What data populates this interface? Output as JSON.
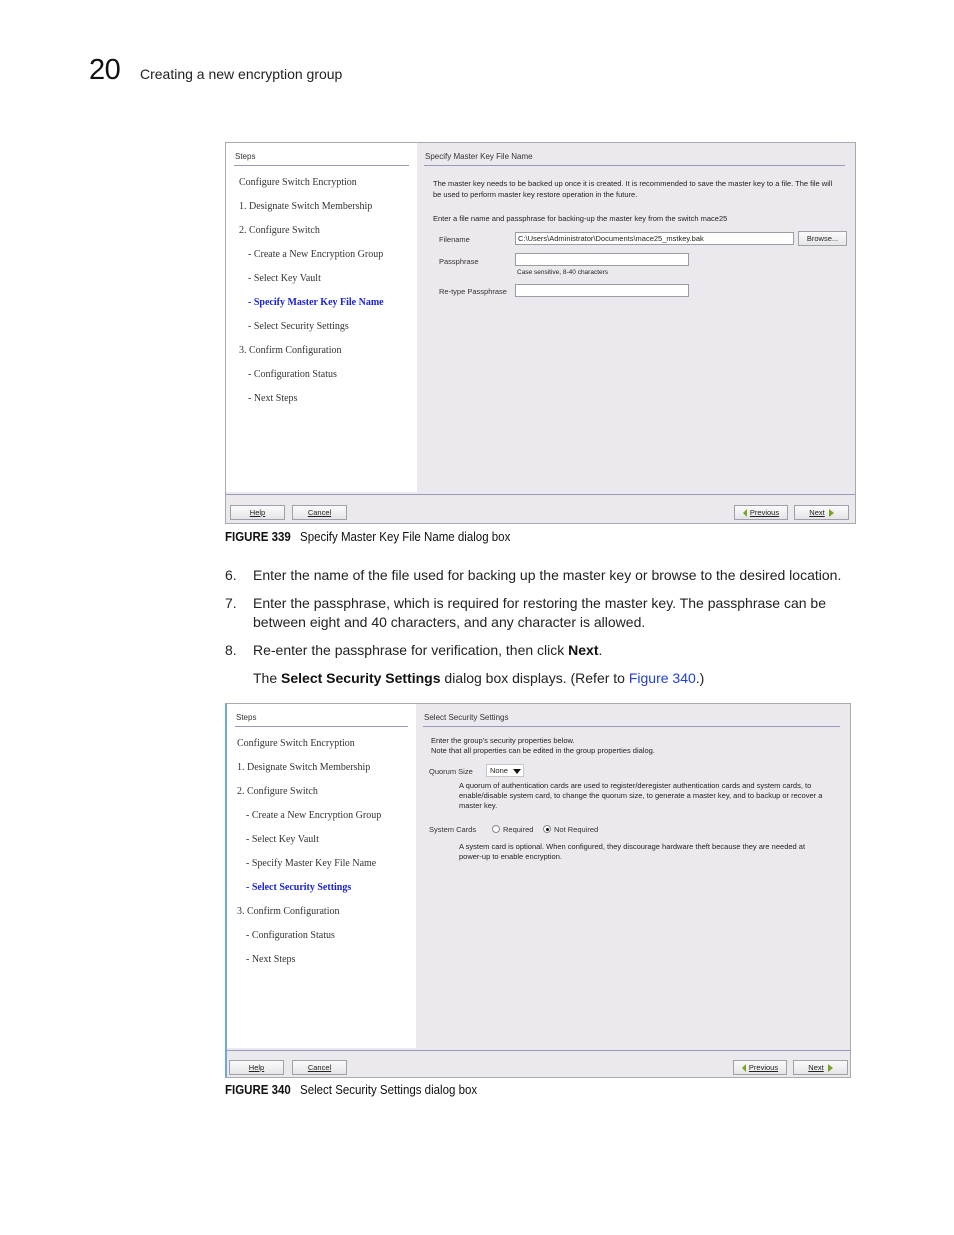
{
  "header": {
    "chapter_number": "20",
    "chapter_title": "Creating a new encryption group"
  },
  "figure339": {
    "steps_heading": "Steps",
    "steps": [
      {
        "label": "Configure Switch Encryption",
        "level": 0,
        "active": false
      },
      {
        "label": "1. Designate Switch Membership",
        "level": 0,
        "active": false
      },
      {
        "label": "2. Configure Switch",
        "level": 0,
        "active": false
      },
      {
        "label": "- Create a New Encryption Group",
        "level": 1,
        "active": false
      },
      {
        "label": "- Select Key Vault",
        "level": 1,
        "active": false
      },
      {
        "label": "- Specify Master Key File Name",
        "level": 1,
        "active": true
      },
      {
        "label": "- Select Security Settings",
        "level": 1,
        "active": false
      },
      {
        "label": "3. Confirm Configuration",
        "level": 0,
        "active": false
      },
      {
        "label": "- Configuration Status",
        "level": 1,
        "active": false
      },
      {
        "label": "- Next Steps",
        "level": 1,
        "active": false
      }
    ],
    "content_heading": "Specify Master Key File Name",
    "intro_line1": "The master key needs to be backed up once it is created. It is recommended to save the master key to a file. The file will",
    "intro_line2": "be used to perform master key restore operation in the future.",
    "instruction": "Enter a file name and passphrase for backing-up the master key from the switch mace25",
    "filename_label": "Filename",
    "filename_value": "C:\\Users\\Administrator\\Documents\\mace25_mstkey.bak",
    "browse_label": "Browse...",
    "passphrase_label": "Passphrase",
    "passphrase_value": "",
    "passphrase_hint": "Case sensitive, 8-40 characters",
    "retype_label": "Re-type Passphrase",
    "retype_value": "",
    "buttons": {
      "help": "Help",
      "cancel": "Cancel",
      "previous": "Previous",
      "next": "Next"
    },
    "caption_number": "FIGURE 339",
    "caption_text": "Specify Master Key File Name dialog box"
  },
  "instructions": [
    {
      "num": "6.",
      "text": "Enter the name of the file used for backing up the master key or browse to the desired location."
    },
    {
      "num": "7.",
      "text_line1": "Enter the passphrase, which is required for restoring the master key. The passphrase can be",
      "text_line2": "between eight and 40 characters, and any character is allowed."
    },
    {
      "num": "8.",
      "text_before": "Re-enter the passphrase for verification, then click ",
      "text_bold": "Next",
      "text_after": "."
    }
  ],
  "result_note": {
    "before": "The ",
    "bold": "Select Security Settings",
    "middle": " dialog box displays. (Refer to ",
    "link": "Figure 340",
    "after": ".)"
  },
  "figure340": {
    "steps_heading": "Steps",
    "steps": [
      {
        "label": "Configure Switch Encryption",
        "level": 0,
        "active": false
      },
      {
        "label": "1. Designate Switch Membership",
        "level": 0,
        "active": false
      },
      {
        "label": "2. Configure Switch",
        "level": 0,
        "active": false
      },
      {
        "label": "- Create a New Encryption Group",
        "level": 1,
        "active": false
      },
      {
        "label": "- Select Key Vault",
        "level": 1,
        "active": false
      },
      {
        "label": "- Specify Master Key File Name",
        "level": 1,
        "active": false
      },
      {
        "label": "- Select Security Settings",
        "level": 1,
        "active": true
      },
      {
        "label": "3. Confirm Configuration",
        "level": 0,
        "active": false
      },
      {
        "label": "- Configuration Status",
        "level": 1,
        "active": false
      },
      {
        "label": "- Next Steps",
        "level": 1,
        "active": false
      }
    ],
    "content_heading": "Select Security Settings",
    "intro_line1": "Enter the group's security properties below.",
    "intro_line2": "Note that all properties can be edited in the group properties dialog.",
    "quorum_label": "Quorum Size",
    "quorum_value": "None",
    "quorum_desc_line1": "A quorum of authentication cards are used to register/deregister authentication cards and system cards, to",
    "quorum_desc_line2": "enable/disable system card, to change the quorum size, to generate a master key, and to backup or recover a",
    "quorum_desc_line3": "master key.",
    "system_cards_label": "System Cards",
    "radio_required": "Required",
    "radio_not_required": "Not Required",
    "system_cards_selected": "Not Required",
    "system_desc_line1": "A system card is optional. When configured, they discourage hardware theft because they are needed at",
    "system_desc_line2": "power-up to enable encryption.",
    "buttons": {
      "help": "Help",
      "cancel": "Cancel",
      "previous": "Previous",
      "next": "Next"
    },
    "caption_number": "FIGURE 340",
    "caption_text": "Select Security Settings dialog box"
  }
}
